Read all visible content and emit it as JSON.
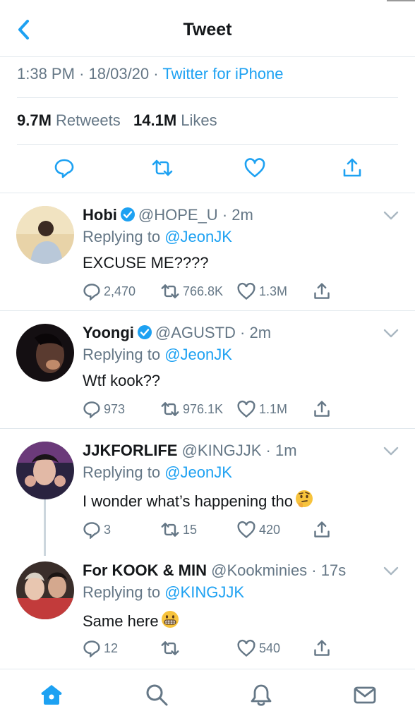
{
  "header": {
    "title": "Tweet"
  },
  "tweet": {
    "time": "1:38 PM",
    "date": "18/03/20",
    "source": "Twitter for iPhone",
    "retweets_count": "9.7M",
    "retweets_label": "Retweets",
    "likes_count": "14.1M",
    "likes_label": "Likes"
  },
  "replies": [
    {
      "name": "Hobi",
      "verified": true,
      "handle": "@HOPE_U",
      "time": "2m",
      "replying_label": "Replying to",
      "replying_to": "@JeonJK",
      "text": "EXCUSE ME????",
      "replies": "2,470",
      "retweets": "766.8K",
      "likes": "1.3M"
    },
    {
      "name": "Yoongi",
      "verified": true,
      "handle": "@AGUSTD",
      "time": "2m",
      "replying_label": "Replying to",
      "replying_to": "@JeonJK",
      "text": "Wtf kook??",
      "replies": "973",
      "retweets": "976.1K",
      "likes": "1.1M"
    },
    {
      "name": "JJKFORLIFE",
      "verified": false,
      "handle": "@KINGJJK",
      "time": "1m",
      "replying_label": "Replying to",
      "replying_to": "@JeonJK",
      "text": "I wonder what’s happening tho",
      "emoji": "thinking-face",
      "replies": "3",
      "retweets": "15",
      "likes": "420"
    },
    {
      "name": "For KOOK & MIN",
      "verified": false,
      "handle": "@Kookminies",
      "time": "17s",
      "replying_label": "Replying to",
      "replying_to": "@KINGJJK",
      "text": "Same here",
      "emoji": "grimacing-face",
      "replies": "12",
      "retweets": "",
      "likes": "540"
    }
  ],
  "tabbar": {
    "items": [
      "home-icon",
      "search-icon",
      "notifications-icon",
      "messages-icon"
    ],
    "active": "home-icon"
  },
  "colors": {
    "accent": "#1da1f2",
    "secondary": "#657786",
    "divider": "#e1e8ed"
  }
}
